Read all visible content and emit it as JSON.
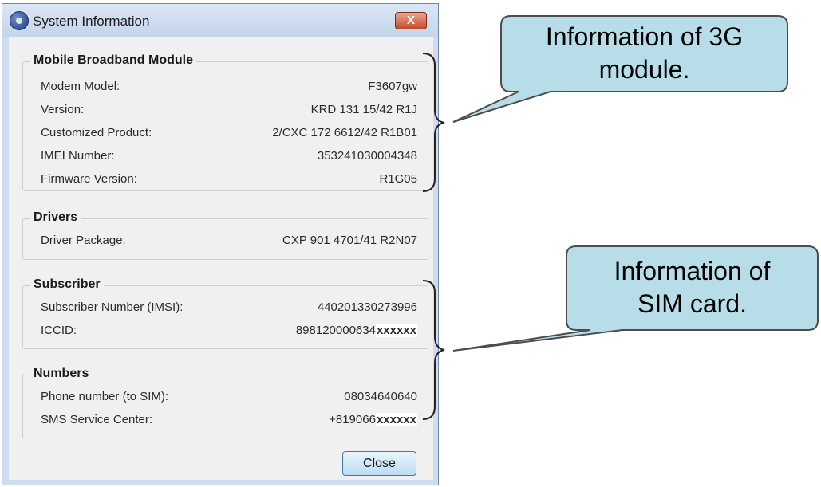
{
  "window": {
    "title": "System Information",
    "close_glyph": "X",
    "title_icon": "app-globe-icon"
  },
  "groups": {
    "mobile": {
      "title": "Mobile Broadband Module",
      "rows": [
        {
          "label": "Modem Model:",
          "value": "F3607gw"
        },
        {
          "label": "Version:",
          "value": "KRD 131 15/42 R1J"
        },
        {
          "label": "Customized Product:",
          "value": "2/CXC 172 6612/42 R1B01"
        },
        {
          "label": "IMEI Number:",
          "value": "353241030004348"
        },
        {
          "label": "Firmware Version:",
          "value": "R1G05"
        }
      ]
    },
    "drivers": {
      "title": "Drivers",
      "rows": [
        {
          "label": "Driver Package:",
          "value": "CXP 901 4701/41 R2N07"
        }
      ]
    },
    "subscriber": {
      "title": "Subscriber",
      "rows": [
        {
          "label": "Subscriber Number (IMSI):",
          "value": "440201330273996"
        },
        {
          "label": "ICCID:",
          "value": "898120000634",
          "mask": "xxxxxx"
        }
      ]
    },
    "numbers": {
      "title": "Numbers",
      "rows": [
        {
          "label": "Phone number (to SIM):",
          "value": "08034640640"
        },
        {
          "label": "SMS Service Center:",
          "value": "+819066",
          "mask": "xxxxxx"
        }
      ]
    }
  },
  "buttons": {
    "close_label": "Close"
  },
  "callouts": {
    "module": {
      "line1": "Information of 3G",
      "line2": "module."
    },
    "sim": {
      "line1": "Information of",
      "line2": "SIM card."
    }
  },
  "colors": {
    "callout_fill": "#b7dde8",
    "callout_stroke": "#4d4d4d",
    "window_frame": "#cfdced"
  }
}
